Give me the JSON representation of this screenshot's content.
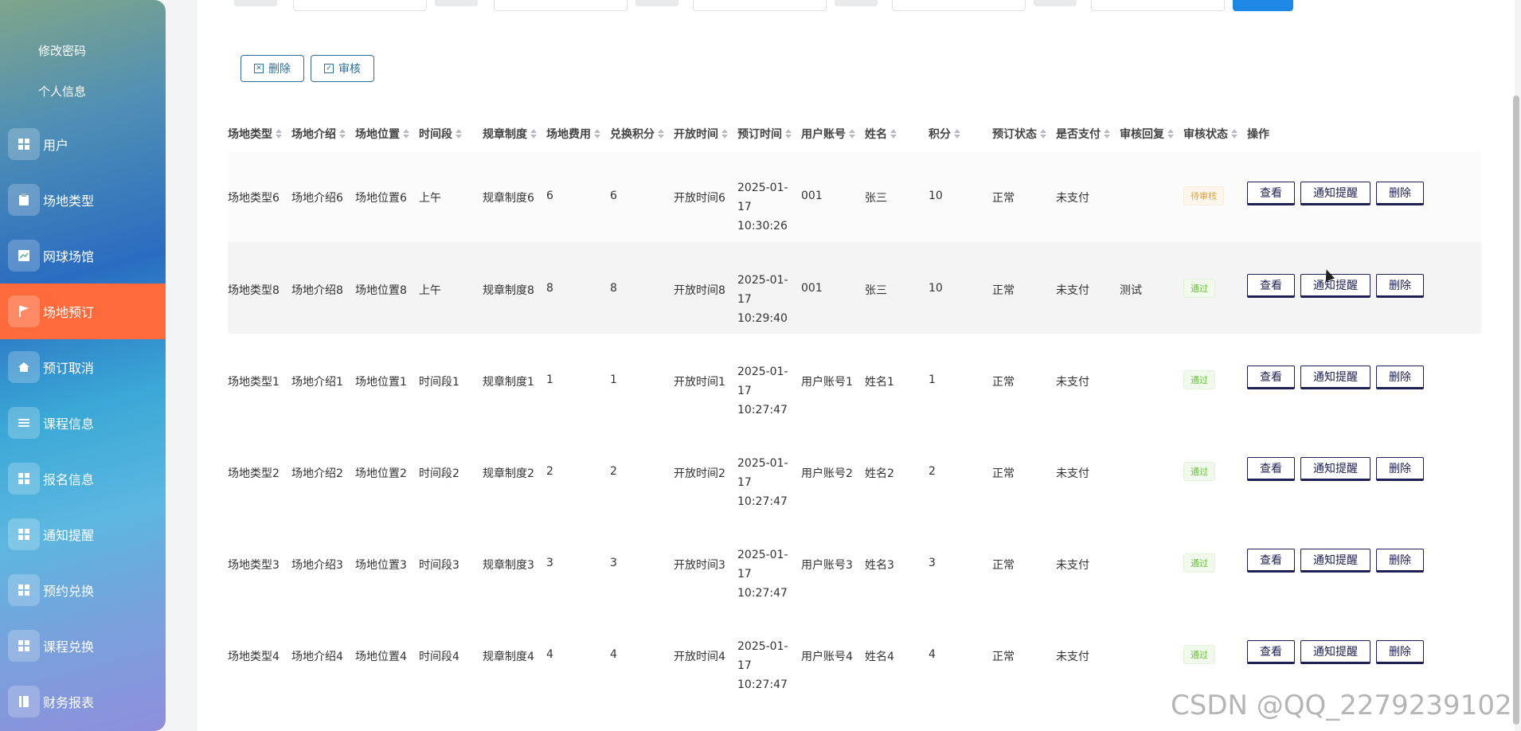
{
  "sidebar": {
    "links": [
      "修改密码",
      "个人信息"
    ],
    "items": [
      {
        "label": "用户",
        "icon": "grid-icon"
      },
      {
        "label": "场地类型",
        "icon": "clipboard-icon"
      },
      {
        "label": "网球场馆",
        "icon": "chart-icon"
      },
      {
        "label": "场地预订",
        "icon": "flag-icon",
        "active": true
      },
      {
        "label": "预订取消",
        "icon": "house-icon"
      },
      {
        "label": "课程信息",
        "icon": "list-icon"
      },
      {
        "label": "报名信息",
        "icon": "grid-icon"
      },
      {
        "label": "通知提醒",
        "icon": "grid-icon"
      },
      {
        "label": "预约兑换",
        "icon": "grid-icon"
      },
      {
        "label": "课程兑换",
        "icon": "grid-icon"
      },
      {
        "label": "财务报表",
        "icon": "book-icon"
      }
    ]
  },
  "toolbar": {
    "delete_label": "删除",
    "audit_label": "审核"
  },
  "table": {
    "headers": [
      "场地类型",
      "场地介绍",
      "场地位置",
      "时间段",
      "规章制度",
      "场地费用",
      "兑换积分",
      "开放时间",
      "预订时间",
      "用户账号",
      "姓名",
      "积分",
      "预订状态",
      "是否支付",
      "审核回复",
      "审核状态",
      "操作"
    ],
    "rows": [
      {
        "type": "场地类型6",
        "intro": "场地介绍6",
        "location": "场地位置6",
        "period": "上午",
        "rules": "规章制度6",
        "fee": "6",
        "points_exchange": "6",
        "open_time": "开放时间6",
        "book_time": "2025-01-17 10:30:26",
        "account": "001",
        "name": "张三",
        "points": "10",
        "status": "正常",
        "paid": "未支付",
        "reply": "",
        "audit": "待审核"
      },
      {
        "type": "场地类型8",
        "intro": "场地介绍8",
        "location": "场地位置8",
        "period": "上午",
        "rules": "规章制度8",
        "fee": "8",
        "points_exchange": "8",
        "open_time": "开放时间8",
        "book_time": "2025-01-17 10:29:40",
        "account": "001",
        "name": "张三",
        "points": "10",
        "status": "正常",
        "paid": "未支付",
        "reply": "测试",
        "audit": "通过"
      },
      {
        "type": "场地类型1",
        "intro": "场地介绍1",
        "location": "场地位置1",
        "period": "时间段1",
        "rules": "规章制度1",
        "fee": "1",
        "points_exchange": "1",
        "open_time": "开放时间1",
        "book_time": "2025-01-17 10:27:47",
        "account": "用户账号1",
        "name": "姓名1",
        "points": "1",
        "status": "正常",
        "paid": "未支付",
        "reply": "",
        "audit": "通过"
      },
      {
        "type": "场地类型2",
        "intro": "场地介绍2",
        "location": "场地位置2",
        "period": "时间段2",
        "rules": "规章制度2",
        "fee": "2",
        "points_exchange": "2",
        "open_time": "开放时间2",
        "book_time": "2025-01-17 10:27:47",
        "account": "用户账号2",
        "name": "姓名2",
        "points": "2",
        "status": "正常",
        "paid": "未支付",
        "reply": "",
        "audit": "通过"
      },
      {
        "type": "场地类型3",
        "intro": "场地介绍3",
        "location": "场地位置3",
        "period": "时间段3",
        "rules": "规章制度3",
        "fee": "3",
        "points_exchange": "3",
        "open_time": "开放时间3",
        "book_time": "2025-01-17 10:27:47",
        "account": "用户账号3",
        "name": "姓名3",
        "points": "3",
        "status": "正常",
        "paid": "未支付",
        "reply": "",
        "audit": "通过"
      },
      {
        "type": "场地类型4",
        "intro": "场地介绍4",
        "location": "场地位置4",
        "period": "时间段4",
        "rules": "规章制度4",
        "fee": "4",
        "points_exchange": "4",
        "open_time": "开放时间4",
        "book_time": "2025-01-17 10:27:47",
        "account": "用户账号4",
        "name": "姓名4",
        "points": "4",
        "status": "正常",
        "paid": "未支付",
        "reply": "",
        "audit": "通过"
      }
    ],
    "actions": [
      "查看",
      "通知提醒",
      "删除"
    ]
  },
  "watermark": "CSDN @QQ_2279239102",
  "colors": {
    "active": "#ff6a3c",
    "primary": "#1e88e5",
    "pass": "#67c23a",
    "pending": "#e6a23c"
  }
}
